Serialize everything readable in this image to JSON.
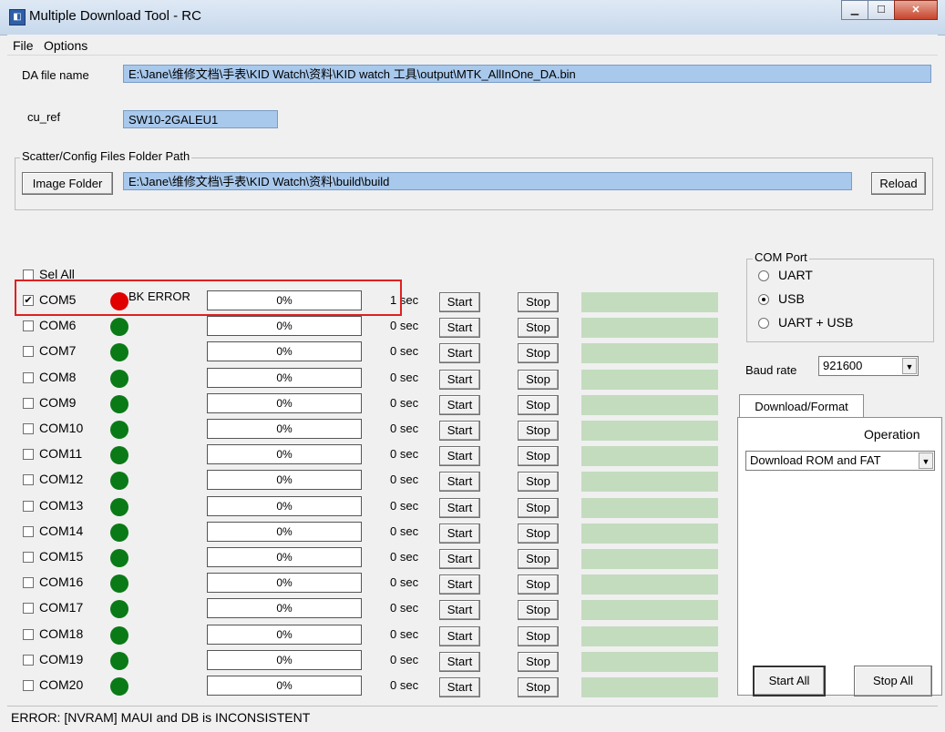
{
  "window": {
    "title": "Multiple Download Tool - RC",
    "app_icon": "app-icon"
  },
  "menu": {
    "file": "File",
    "options": "Options"
  },
  "da_file": {
    "label": "DA file name",
    "value": "E:\\Jane\\维修文档\\手表\\KID Watch\\资料\\KID watch 工具\\output\\MTK_AllInOne_DA.bin"
  },
  "cu_ref": {
    "label": "cu_ref",
    "value": "SW10-2GALEU1"
  },
  "scatter": {
    "group_label": "Scatter/Config Files Folder Path",
    "image_folder_button": "Image Folder",
    "path": "E:\\Jane\\维修文档\\手表\\KID Watch\\资料\\build\\build",
    "reload_button": "Reload"
  },
  "sel_all": "Sel All",
  "rows": [
    {
      "port": "COM5",
      "checked": true,
      "led": "red",
      "status": "BK ERROR",
      "progress": "0%",
      "time": "1 sec",
      "start": "Start",
      "stop": "Stop"
    },
    {
      "port": "COM6",
      "checked": false,
      "led": "green",
      "status": "",
      "progress": "0%",
      "time": "0 sec",
      "start": "Start",
      "stop": "Stop"
    },
    {
      "port": "COM7",
      "checked": false,
      "led": "green",
      "status": "",
      "progress": "0%",
      "time": "0 sec",
      "start": "Start",
      "stop": "Stop"
    },
    {
      "port": "COM8",
      "checked": false,
      "led": "green",
      "status": "",
      "progress": "0%",
      "time": "0 sec",
      "start": "Start",
      "stop": "Stop"
    },
    {
      "port": "COM9",
      "checked": false,
      "led": "green",
      "status": "",
      "progress": "0%",
      "time": "0 sec",
      "start": "Start",
      "stop": "Stop"
    },
    {
      "port": "COM10",
      "checked": false,
      "led": "green",
      "status": "",
      "progress": "0%",
      "time": "0 sec",
      "start": "Start",
      "stop": "Stop"
    },
    {
      "port": "COM11",
      "checked": false,
      "led": "green",
      "status": "",
      "progress": "0%",
      "time": "0 sec",
      "start": "Start",
      "stop": "Stop"
    },
    {
      "port": "COM12",
      "checked": false,
      "led": "green",
      "status": "",
      "progress": "0%",
      "time": "0 sec",
      "start": "Start",
      "stop": "Stop"
    },
    {
      "port": "COM13",
      "checked": false,
      "led": "green",
      "status": "",
      "progress": "0%",
      "time": "0 sec",
      "start": "Start",
      "stop": "Stop"
    },
    {
      "port": "COM14",
      "checked": false,
      "led": "green",
      "status": "",
      "progress": "0%",
      "time": "0 sec",
      "start": "Start",
      "stop": "Stop"
    },
    {
      "port": "COM15",
      "checked": false,
      "led": "green",
      "status": "",
      "progress": "0%",
      "time": "0 sec",
      "start": "Start",
      "stop": "Stop"
    },
    {
      "port": "COM16",
      "checked": false,
      "led": "green",
      "status": "",
      "progress": "0%",
      "time": "0 sec",
      "start": "Start",
      "stop": "Stop"
    },
    {
      "port": "COM17",
      "checked": false,
      "led": "green",
      "status": "",
      "progress": "0%",
      "time": "0 sec",
      "start": "Start",
      "stop": "Stop"
    },
    {
      "port": "COM18",
      "checked": false,
      "led": "green",
      "status": "",
      "progress": "0%",
      "time": "0 sec",
      "start": "Start",
      "stop": "Stop"
    },
    {
      "port": "COM19",
      "checked": false,
      "led": "green",
      "status": "",
      "progress": "0%",
      "time": "0 sec",
      "start": "Start",
      "stop": "Stop"
    },
    {
      "port": "COM20",
      "checked": false,
      "led": "green",
      "status": "",
      "progress": "0%",
      "time": "0 sec",
      "start": "Start",
      "stop": "Stop"
    }
  ],
  "com_port": {
    "group_label": "COM Port",
    "options": [
      "UART",
      "USB",
      "UART + USB"
    ],
    "selected": "USB"
  },
  "baud_rate": {
    "label": "Baud rate",
    "value": "921600"
  },
  "tab": {
    "label": "Download/Format",
    "operation_label": "Operation",
    "operation_value": "Download ROM and FAT"
  },
  "buttons": {
    "start_all": "Start All",
    "stop_all": "Stop All"
  },
  "status_bar": "ERROR: [NVRAM] MAUI and DB is INCONSISTENT",
  "colors": {
    "led_green": "#0a7a16",
    "led_red": "#e00000",
    "field_bg": "#a8c8ec",
    "progress_green": "#c3dcbe",
    "highlight": "#e02020"
  }
}
